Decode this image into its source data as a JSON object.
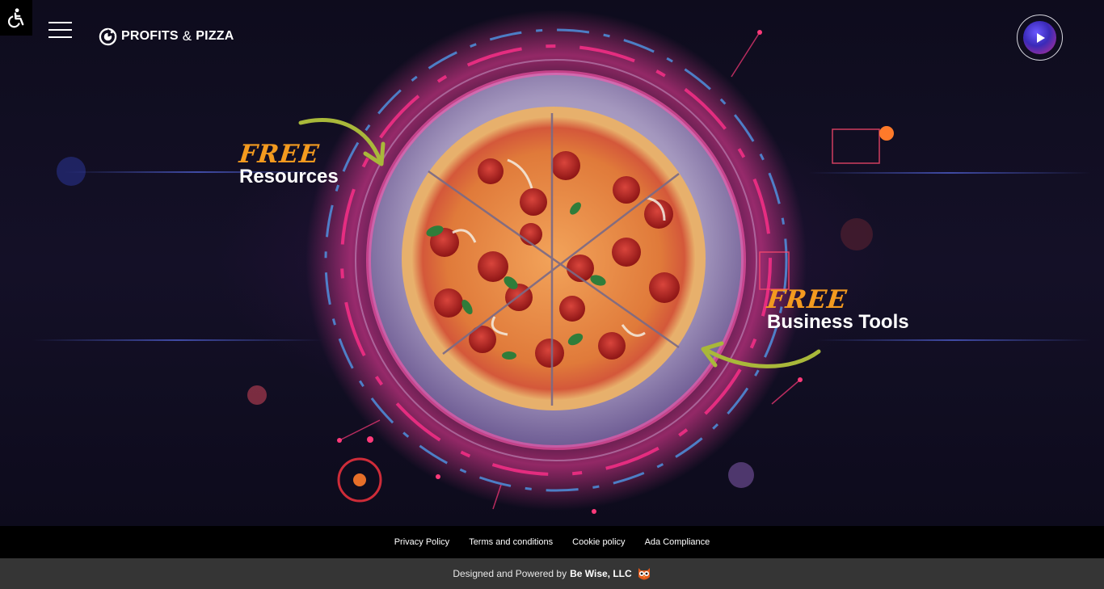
{
  "header": {
    "brand_left": "PROFITS",
    "brand_amp": "&",
    "brand_right": "PIZZA"
  },
  "hero": {
    "callouts": [
      {
        "tag": "FREE",
        "title": "Resources"
      },
      {
        "tag": "FREE",
        "title": "Business Tools"
      }
    ]
  },
  "footer": {
    "links": [
      "Privacy Policy",
      "Terms and conditions",
      "Cookie policy",
      "Ada Compliance"
    ],
    "credit_prefix": "Designed and Powered by",
    "credit_company": "Be Wise, LLC"
  },
  "colors": {
    "accent_orange": "#f39a1f",
    "arrow_green": "#a9b83a",
    "footer_top": "#000000",
    "footer_bottom": "#353535"
  },
  "icons": [
    "accessibility-icon",
    "menu-icon",
    "logo-icon",
    "play-icon",
    "owl-icon"
  ]
}
